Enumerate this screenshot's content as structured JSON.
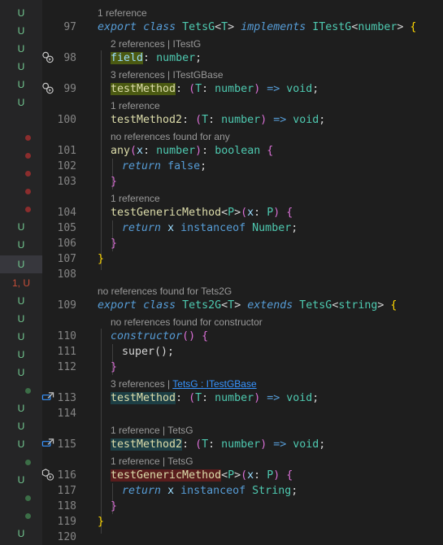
{
  "colors": {
    "modified_indicator": "#73c991",
    "error_indicator": "#c74e39",
    "keyword": "#569cd6",
    "type": "#4ec9b0",
    "function": "#dcdcaa",
    "property": "#9cdcfe",
    "codelens": "#999999",
    "link": "#3794ff"
  },
  "gutter_indicators": {
    "u": "U",
    "err": "1, U"
  },
  "codelens": {
    "c1": "1 reference",
    "c2": "2 references | ITestG",
    "c3": "3 references | ITestGBase",
    "c4": "1 reference",
    "c5": "no references found for any",
    "c6": "1 reference",
    "c7": "no references found for Tets2G",
    "c8": "no references found for constructor",
    "c9_prefix": "3 references | ",
    "c9_link": "TetsG : ITestGBase",
    "c10": "1 reference | TetsG",
    "c11": "1 reference | TetsG"
  },
  "line_numbers": [
    "97",
    "98",
    "99",
    "100",
    "101",
    "102",
    "103",
    "104",
    "105",
    "106",
    "107",
    "108",
    "109",
    "110",
    "111",
    "112",
    "113",
    "114",
    "115",
    "116",
    "117",
    "118",
    "119",
    "120"
  ],
  "code": {
    "export": "export",
    "class": "class",
    "implements": "implements",
    "extends": "extends",
    "return": "return",
    "instanceof": "instanceof",
    "constructor": "constructor",
    "tetsg": "TetsG",
    "tets2g": "Tets2G",
    "t": "T",
    "p": "P",
    "x": "x",
    "itestg": "ITestG",
    "number": "number",
    "string": "string",
    "boolean": "boolean",
    "void": "void",
    "false": "false",
    "Number": "Number",
    "String": "String",
    "field": "field",
    "testMethod": "testMethod",
    "testMethod2": "testMethod2",
    "any": "any",
    "testGenericMethod": "testGenericMethod",
    "super": "super",
    "lt": "<",
    "gt": ">",
    "lp": "(",
    "rp": ")",
    "lb": "{",
    "rb": "}",
    "colon": ":",
    "semi": ";",
    "arrow": "=>",
    "paren_pair": "()",
    "super_call_end": "();"
  }
}
